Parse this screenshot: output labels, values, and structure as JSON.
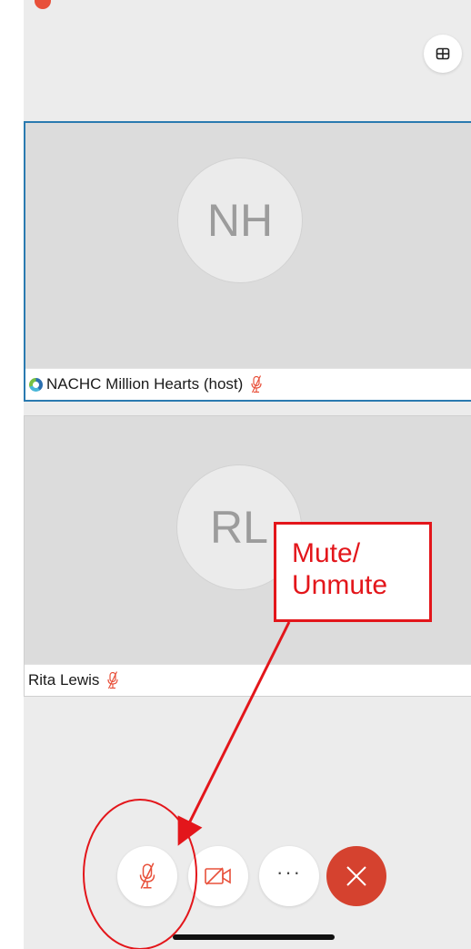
{
  "participants": [
    {
      "initials": "NH",
      "name": "NACHC Million Hearts (host)",
      "muted": true,
      "active_speaker": true
    },
    {
      "initials": "RL",
      "name": "Rita Lewis",
      "muted": true,
      "active_speaker": false
    }
  ],
  "controls": {
    "mute_icon": "mic-muted-icon",
    "video_icon": "video-off-icon",
    "more_label": "···",
    "end_icon": "close-icon"
  },
  "annotation": {
    "line1": "Mute/",
    "line2": "Unmute"
  },
  "colors": {
    "background": "#ececec",
    "tile": "#dcdcdc",
    "active_border": "#2a7ab0",
    "muted_red": "#e8503a",
    "end_call": "#d5422f",
    "annotation_red": "#e3161b"
  }
}
